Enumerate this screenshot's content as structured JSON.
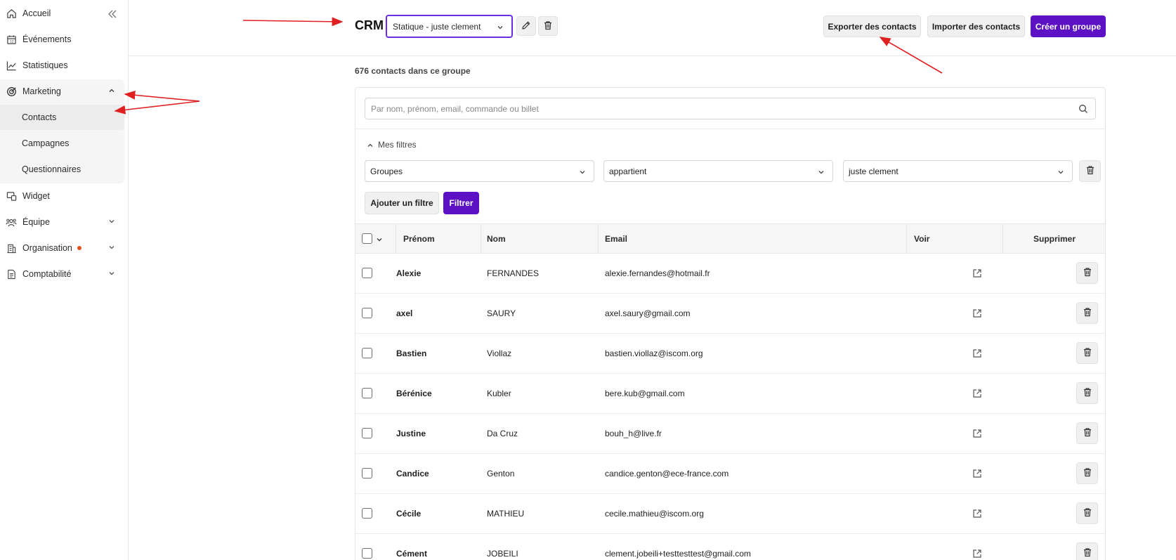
{
  "sidebar": {
    "items": [
      {
        "label": "Accueil"
      },
      {
        "label": "Événements"
      },
      {
        "label": "Statistiques"
      },
      {
        "label": "Marketing"
      },
      {
        "label": "Widget"
      },
      {
        "label": "Équipe"
      },
      {
        "label": "Organisation"
      },
      {
        "label": "Comptabilité"
      }
    ],
    "marketing_sub": [
      {
        "label": "Contacts"
      },
      {
        "label": "Campagnes"
      },
      {
        "label": "Questionnaires"
      }
    ]
  },
  "header": {
    "title": "CRM",
    "group_select_value": "Statique - juste clement",
    "export_label": "Exporter des contacts",
    "import_label": "Importer des contacts",
    "create_group_label": "Créer un groupe"
  },
  "main": {
    "count_text": "676 contacts dans ce groupe",
    "search_placeholder": "Par nom, prénom, email, commande ou billet",
    "filters_label": "Mes filtres",
    "filter_field": "Groupes",
    "filter_operator": "appartient",
    "filter_value": "juste clement",
    "add_filter_label": "Ajouter un filtre",
    "apply_filter_label": "Filtrer"
  },
  "table": {
    "headers": {
      "prenom": "Prénom",
      "nom": "Nom",
      "email": "Email",
      "voir": "Voir",
      "supprimer": "Supprimer"
    },
    "rows": [
      {
        "prenom": "Alexie",
        "nom": "FERNANDES",
        "email": "alexie.fernandes@hotmail.fr"
      },
      {
        "prenom": "axel",
        "nom": "SAURY",
        "email": "axel.saury@gmail.com"
      },
      {
        "prenom": "Bastien",
        "nom": "Viollaz",
        "email": "bastien.viollaz@iscom.org"
      },
      {
        "prenom": "Bérénice",
        "nom": "Kubler",
        "email": "bere.kub@gmail.com"
      },
      {
        "prenom": "Justine",
        "nom": "Da Cruz",
        "email": "bouh_h@live.fr"
      },
      {
        "prenom": "Candice",
        "nom": "Genton",
        "email": "candice.genton@ece-france.com"
      },
      {
        "prenom": "Cécile",
        "nom": "MATHIEU",
        "email": "cecile.mathieu@iscom.org"
      },
      {
        "prenom": "Cément",
        "nom": "JOBEILI",
        "email": "clement.jobeili+testtesttest@gmail.com"
      }
    ]
  },
  "colors": {
    "accent": "#5c12c4",
    "select_border": "#6b2ee8",
    "annotation_arrow": "#e02020",
    "notification_dot": "#e0521f"
  }
}
